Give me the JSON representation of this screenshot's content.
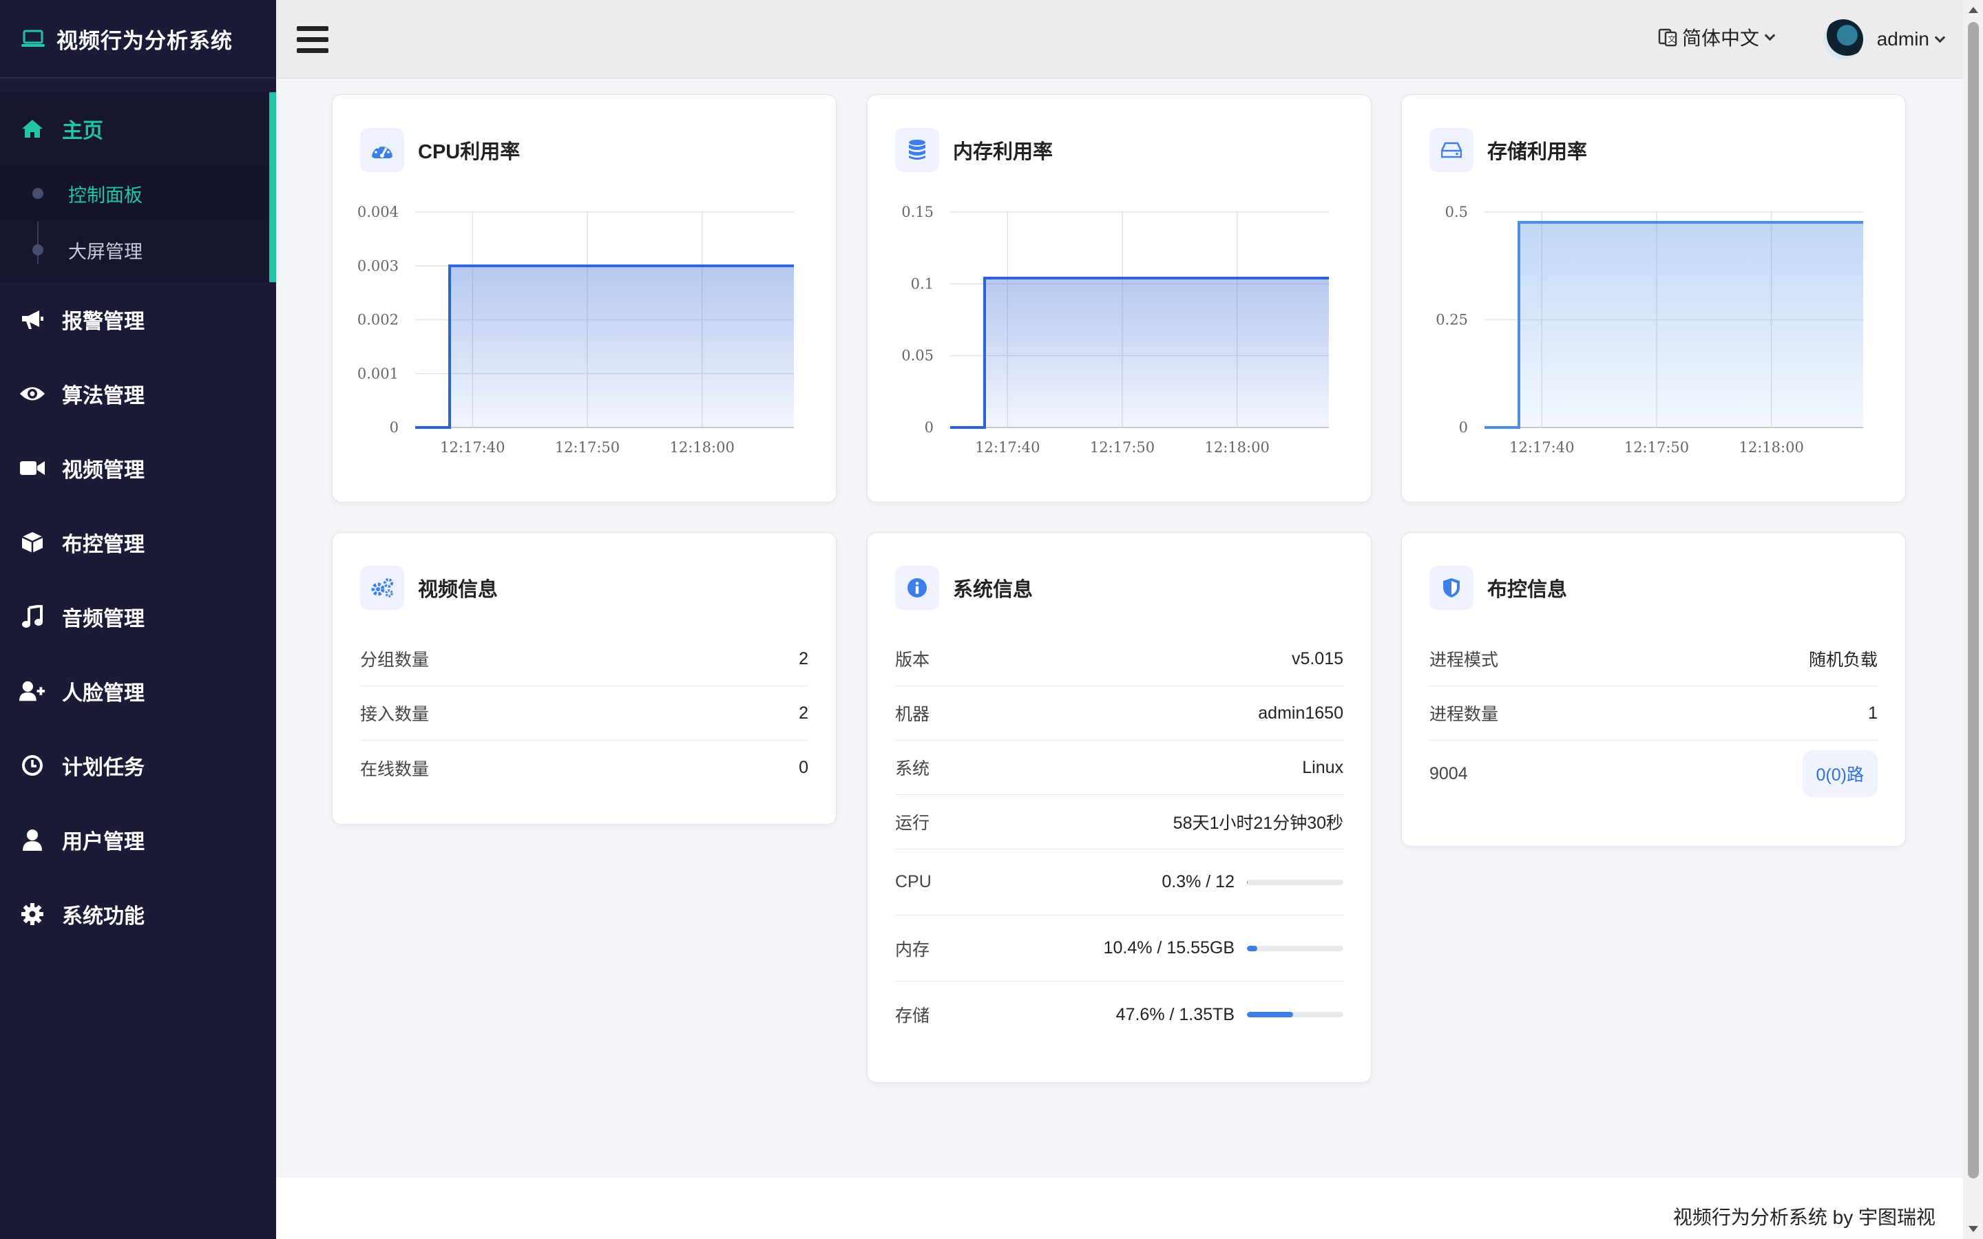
{
  "app": {
    "title": "视频行为分析系统"
  },
  "sidebar": {
    "items": [
      {
        "label": "主页",
        "icon": "home-icon",
        "active": true
      },
      {
        "label": "报警管理",
        "icon": "megaphone-icon"
      },
      {
        "label": "算法管理",
        "icon": "eye-icon"
      },
      {
        "label": "视频管理",
        "icon": "video-camera-icon"
      },
      {
        "label": "布控管理",
        "icon": "cube-icon"
      },
      {
        "label": "音频管理",
        "icon": "music-note-icon"
      },
      {
        "label": "人脸管理",
        "icon": "user-plus-icon"
      },
      {
        "label": "计划任务",
        "icon": "clock-icon"
      },
      {
        "label": "用户管理",
        "icon": "user-icon"
      },
      {
        "label": "系统功能",
        "icon": "gear-icon"
      }
    ],
    "sub_items": [
      {
        "label": "控制面板",
        "active": true
      },
      {
        "label": "大屏管理"
      }
    ]
  },
  "header": {
    "language": "简体中文",
    "username": "admin"
  },
  "cards": {
    "cpu": {
      "title": "CPU利用率"
    },
    "memory": {
      "title": "内存利用率"
    },
    "storage": {
      "title": "存储利用率"
    },
    "video": {
      "title": "视频信息",
      "rows": [
        {
          "label": "分组数量",
          "value": "2"
        },
        {
          "label": "接入数量",
          "value": "2"
        },
        {
          "label": "在线数量",
          "value": "0"
        }
      ]
    },
    "system": {
      "title": "系统信息",
      "rows": [
        {
          "label": "版本",
          "value": "v5.015"
        },
        {
          "label": "机器",
          "value": "admin1650"
        },
        {
          "label": "系统",
          "value": "Linux"
        },
        {
          "label": "运行",
          "value": "58天1小时21分钟30秒"
        }
      ],
      "usage": [
        {
          "label": "CPU",
          "value": "0.3% / 12",
          "percent": 0.3
        },
        {
          "label": "内存",
          "value": "10.4% / 15.55GB",
          "percent": 10.4
        },
        {
          "label": "存储",
          "value": "47.6% / 1.35TB",
          "percent": 47.6
        }
      ]
    },
    "deploy": {
      "title": "布控信息",
      "rows": [
        {
          "label": "进程模式",
          "value": "随机负载"
        },
        {
          "label": "进程数量",
          "value": "1"
        }
      ],
      "port": {
        "label": "9004",
        "tag": "0(0)路"
      }
    }
  },
  "chart_data": [
    {
      "type": "area",
      "title": "CPU利用率",
      "x": [
        "12:17:35",
        "12:17:38",
        "12:17:38",
        "12:18:08"
      ],
      "y": [
        0,
        0,
        0.003,
        0.003
      ],
      "xticks": [
        "12:17:40",
        "12:17:50",
        "12:18:00"
      ],
      "yticks": [
        "0",
        "0.001",
        "0.002",
        "0.003",
        "0.004"
      ],
      "ylim": [
        0,
        0.004
      ],
      "grid": true,
      "color": "#2d63d8"
    },
    {
      "type": "area",
      "title": "内存利用率",
      "x": [
        "12:17:35",
        "12:17:38",
        "12:17:38",
        "12:18:08"
      ],
      "y": [
        0,
        0,
        0.104,
        0.104
      ],
      "xticks": [
        "12:17:40",
        "12:17:50",
        "12:18:00"
      ],
      "yticks": [
        "0",
        "0.05",
        "0.1",
        "0.15"
      ],
      "ylim": [
        0,
        0.15
      ],
      "grid": true,
      "color": "#2d63d8"
    },
    {
      "type": "area",
      "title": "存储利用率",
      "x": [
        "12:17:35",
        "12:17:38",
        "12:17:38",
        "12:18:08"
      ],
      "y": [
        0,
        0,
        0.476,
        0.476
      ],
      "xticks": [
        "12:17:40",
        "12:17:50",
        "12:18:00"
      ],
      "yticks": [
        "0",
        "0.25",
        "0.5"
      ],
      "ylim": [
        0,
        0.5
      ],
      "grid": true,
      "color": "#4a8ee8"
    }
  ],
  "footer": {
    "text": "视频行为分析系统 by 宇图瑞视"
  }
}
